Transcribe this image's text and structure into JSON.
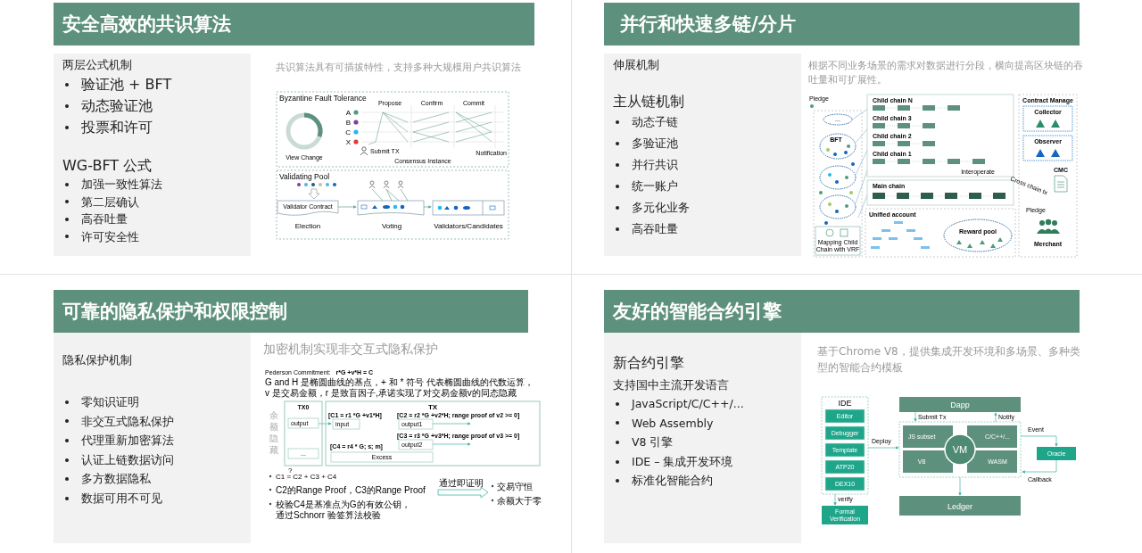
{
  "sections": [
    {
      "title": "安全高效的共识算法",
      "blocks": [
        {
          "kind": "label",
          "text": "两层公式机制"
        },
        {
          "kind": "bullets-large",
          "items": [
            "验证池 + BFT",
            "动态验证池",
            "投票和许可"
          ]
        },
        {
          "kind": "title",
          "text": "WG-BFT 公式"
        },
        {
          "kind": "bullets-small",
          "items": [
            "加强一致性算法",
            "第二层确认",
            "高吞吐量",
            "许可安全性"
          ]
        }
      ],
      "caption": "共识算法具有可插拔特性，支持多种大规模用户共识算法",
      "figure": {
        "kind": "bft",
        "title": "Byzantine Fault Tolerance",
        "ring_label": "View Change",
        "nodes": [
          {
            "label": "A",
            "color": "#4e9a7e"
          },
          {
            "label": "B",
            "color": "#7b3fa6"
          },
          {
            "label": "C",
            "color": "#29b6f6"
          },
          {
            "label": "X",
            "color": "#e53935"
          }
        ],
        "phases": [
          "Propose",
          "Confirm",
          "Commit"
        ],
        "submit": "Submit TX",
        "notification": "Notification",
        "instance": "Consensus Instance",
        "pool_title": "Validating Pool",
        "contract": "Validator Contract",
        "stages": [
          "Election",
          "Voting",
          "Validators/Candidates"
        ]
      }
    },
    {
      "title": "并行和快速多链/分片",
      "blocks": [
        {
          "kind": "label",
          "text": "伸展机制"
        },
        {
          "kind": "title",
          "text": "主从链机制"
        },
        {
          "kind": "bullets-small",
          "items": [
            "动态子链",
            "多验证池",
            "并行共识",
            "统一账户",
            "多元化业务",
            "高吞吐量"
          ]
        }
      ],
      "caption": "根据不同业务场景的需求对数据进行分段，横向提高区块链的吞吐量和可扩展性。",
      "figure": {
        "kind": "chains",
        "pledge_left": "Pledge",
        "more": "...",
        "bft": "BFT",
        "child_chains": [
          "Child chain N",
          "Child chain 3",
          "Child chain 2",
          "Child chain 1"
        ],
        "interoperate": "Interoperate",
        "main_chain": "Main chain",
        "unified": "Unified account",
        "reward": "Reward pool",
        "mapping": [
          "Mapping Child",
          "Chain with VRF"
        ],
        "manage": "Contract Manage",
        "collector": "Collector",
        "observer": "Observer",
        "cmc": "CMC",
        "cross": "Cross chain tx",
        "pledge_right": "Pledge",
        "merchant": "Merchant"
      }
    },
    {
      "title": "可靠的隐私保护和权限控制",
      "blocks": [
        {
          "kind": "label",
          "text": "隐私保护机制"
        },
        {
          "kind": "bullets-small",
          "items": [
            "零知识证明",
            "非交互式隐私保护",
            "代理重新加密算法",
            "认证上链数据访问",
            "多方数据隐私",
            "数据可用不可见"
          ]
        }
      ],
      "caption": "加密机制实现非交互式隐私保护",
      "figure": {
        "kind": "privacy",
        "formula_label": "Pederson Commitment:",
        "formula": "r*G +v*H = C",
        "note": [
          "G and H 是椭圆曲线的基点，+ 和 * 符号 代表椭圆曲线的代数运算，",
          "v 是交易金额，r 是致盲因子,承诺实现了对交易金额v的同态隐藏"
        ],
        "side": "余额隐藏",
        "tx0": "TX0",
        "tx": "TX",
        "tx0_outputs": [
          "output",
          "..."
        ],
        "c1": "[C1 = r1 *G +v1*H]",
        "input": "input",
        "c2": "[C2 = r2 *G +v2*H; range proof of v2 >= 0]",
        "out1": "output1",
        "c3": "[C3 = r3 *G +v3*H; range proof of v3 >= 0]",
        "out2": "output2",
        "c4": "[C4 = r4 * G; s; m]",
        "excess": "Excess",
        "question": "?",
        "checks": [
          [
            "C1 = C2 + C3 + C4"
          ],
          [
            "C2的Range Proof，C3的Range Proof"
          ],
          [
            "校验C4是基准点为G的有效公钥，",
            "通过Schnorr 验签算法校验"
          ]
        ],
        "arrow": "通过即证明",
        "results": [
          "交易守恒",
          "余额大于零"
        ]
      }
    },
    {
      "title": "友好的智能合约引擎",
      "blocks": [
        {
          "kind": "title",
          "text": "新合约引擎"
        },
        {
          "kind": "label",
          "text": "支持国中主流开发语言"
        },
        {
          "kind": "bullets-small",
          "items": [
            "JavaScript/C/C++/...",
            "Web Assembly",
            "V8 引擎",
            "IDE – 集成开发环境",
            "标准化智能合约"
          ]
        }
      ],
      "caption": "基于Chrome V8，提供集成开发环境和多场景、多种类型的智能合约模板",
      "figure": {
        "kind": "vm",
        "ide": "IDE",
        "tools": [
          "Editor",
          "Debugger",
          "Template",
          "ATP20",
          "DEX10"
        ],
        "verify": "verify",
        "formal": [
          "Formal",
          "Verification"
        ],
        "deploy": "Deploy",
        "dapp": "Dapp",
        "submit": "Submit Tx",
        "notify": "Notify",
        "engines": [
          "JS subset",
          "C/C++/...",
          "V8",
          "WASM"
        ],
        "vm": "VM",
        "event": "Event",
        "oracle": "Oracle",
        "callback": "Callback",
        "ledger": "Ledger"
      }
    }
  ]
}
